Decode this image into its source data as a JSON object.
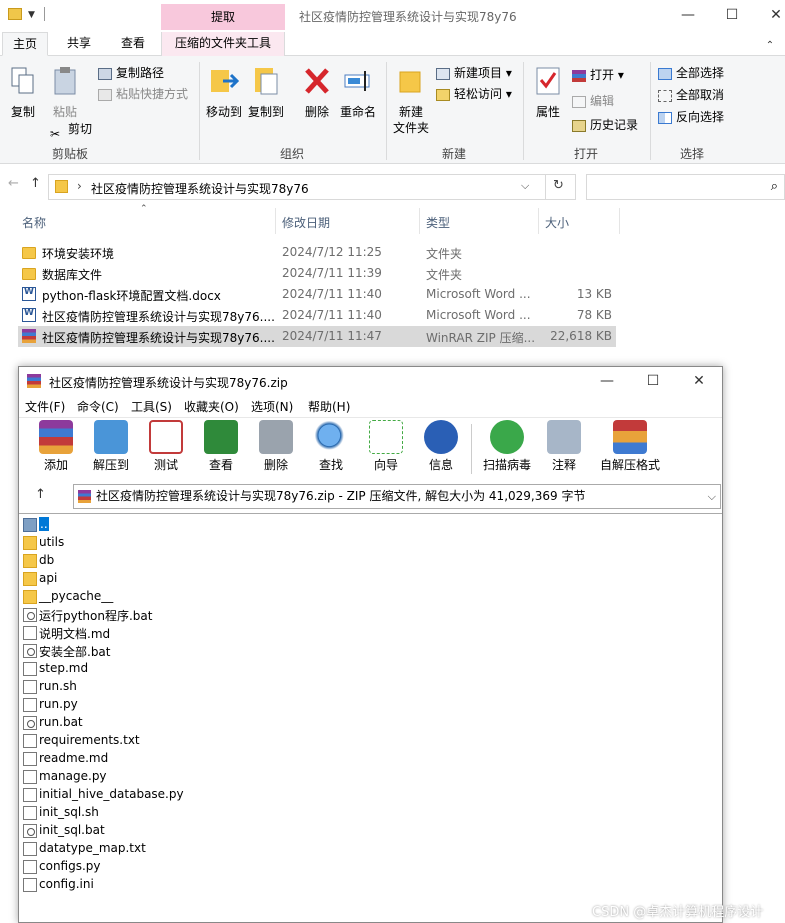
{
  "explorer": {
    "tool_tab_top": "提取",
    "window_title": "社区疫情防控管理系统设计与实现78y76",
    "ribbon_tabs": [
      "主页",
      "共享",
      "查看",
      "压缩的文件夹工具"
    ],
    "ribbon": {
      "copy": "复制",
      "paste": "粘贴",
      "copy_path": "复制路径",
      "paste_shortcut": "粘贴快捷方式",
      "cut": "剪切",
      "group_clipboard": "剪贴板",
      "move_to": "移动到",
      "copy_to": "复制到",
      "delete": "删除",
      "rename": "重命名",
      "group_organize": "组织",
      "new_folder": "新建\n文件夹",
      "new_item": "新建项目",
      "easy_access": "轻松访问",
      "group_new": "新建",
      "properties": "属性",
      "open": "打开",
      "edit": "编辑",
      "history": "历史记录",
      "group_open": "打开",
      "select_all": "全部选择",
      "select_none": "全部取消",
      "invert_selection": "反向选择",
      "group_select": "选择"
    },
    "address": "社区疫情防控管理系统设计与实现78y76",
    "columns": {
      "name": "名称",
      "date": "修改日期",
      "type": "类型",
      "size": "大小"
    },
    "files": [
      {
        "name": "环境安装环境",
        "date": "2024/7/12 11:25",
        "type": "文件夹",
        "size": "",
        "icon": "folder"
      },
      {
        "name": "数据库文件",
        "date": "2024/7/11 11:39",
        "type": "文件夹",
        "size": "",
        "icon": "folder"
      },
      {
        "name": "python-flask环境配置文档.docx",
        "date": "2024/7/11 11:40",
        "type": "Microsoft Word ...",
        "size": "13 KB",
        "icon": "word"
      },
      {
        "name": "社区疫情防控管理系统设计与实现78y76....",
        "date": "2024/7/11 11:40",
        "type": "Microsoft Word ...",
        "size": "78 KB",
        "icon": "word"
      },
      {
        "name": "社区疫情防控管理系统设计与实现78y76....",
        "date": "2024/7/11 11:47",
        "type": "WinRAR ZIP 压缩...",
        "size": "22,618 KB",
        "icon": "rar"
      }
    ]
  },
  "rar": {
    "title": "社区疫情防控管理系统设计与实现78y76.zip",
    "menu": [
      "文件(F)",
      "命令(C)",
      "工具(S)",
      "收藏夹(O)",
      "选项(N)",
      "帮助(H)"
    ],
    "toolbar": [
      "添加",
      "解压到",
      "测试",
      "查看",
      "删除",
      "查找",
      "向导",
      "信息",
      "扫描病毒",
      "注释",
      "自解压格式"
    ],
    "path": "社区疫情防控管理系统设计与实现78y76.zip - ZIP 压缩文件, 解包大小为 41,029,369 字节",
    "entries": [
      {
        "name": "..",
        "icon": "up"
      },
      {
        "name": "utils",
        "icon": "folder"
      },
      {
        "name": "db",
        "icon": "folder"
      },
      {
        "name": "api",
        "icon": "folder"
      },
      {
        "name": "__pycache__",
        "icon": "folder"
      },
      {
        "name": "运行python程序.bat",
        "icon": "bat"
      },
      {
        "name": "说明文档.md",
        "icon": "file"
      },
      {
        "name": "安装全部.bat",
        "icon": "bat"
      },
      {
        "name": "step.md",
        "icon": "file"
      },
      {
        "name": "run.sh",
        "icon": "file"
      },
      {
        "name": "run.py",
        "icon": "file"
      },
      {
        "name": "run.bat",
        "icon": "bat"
      },
      {
        "name": "requirements.txt",
        "icon": "file"
      },
      {
        "name": "readme.md",
        "icon": "file"
      },
      {
        "name": "manage.py",
        "icon": "file"
      },
      {
        "name": "initial_hive_database.py",
        "icon": "file"
      },
      {
        "name": "init_sql.sh",
        "icon": "file"
      },
      {
        "name": "init_sql.bat",
        "icon": "bat"
      },
      {
        "name": "datatype_map.txt",
        "icon": "file"
      },
      {
        "name": "configs.py",
        "icon": "file"
      },
      {
        "name": "config.ini",
        "icon": "ini"
      }
    ]
  },
  "watermark": "CSDN @卓杰计算机程序设计"
}
